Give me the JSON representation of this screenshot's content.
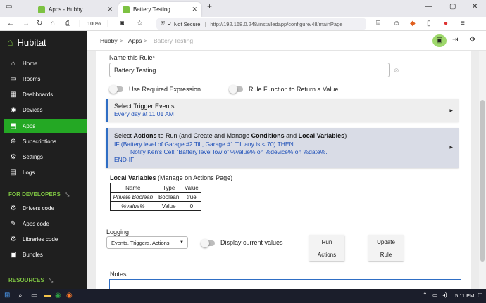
{
  "browser": {
    "tabs": [
      {
        "label": "Apps - Hubby",
        "active": false
      },
      {
        "label": "Battery Testing",
        "active": true
      }
    ],
    "new_tab": "+",
    "zoom": "100%",
    "security": "Not Secure",
    "url": "http://192.168.0.248/installedapp/configure/48/mainPage"
  },
  "sidebar": {
    "brand": "Hubitat",
    "items": [
      {
        "label": "Home",
        "icon": "home-icon",
        "glyph": "⌂"
      },
      {
        "label": "Rooms",
        "icon": "rooms-icon",
        "glyph": "▭"
      },
      {
        "label": "Dashboards",
        "icon": "dashboard-icon",
        "glyph": "▦"
      },
      {
        "label": "Devices",
        "icon": "bulb-icon",
        "glyph": "◉"
      },
      {
        "label": "Apps",
        "icon": "apps-icon",
        "glyph": "⬒"
      },
      {
        "label": "Subscriptions",
        "icon": "subscriptions-icon",
        "glyph": "⊛"
      },
      {
        "label": "Settings",
        "icon": "gear-icon",
        "glyph": "⚙"
      },
      {
        "label": "Logs",
        "icon": "logs-icon",
        "glyph": "▤"
      }
    ],
    "dev_section": "FOR DEVELOPERS",
    "dev_items": [
      {
        "label": "Drivers code",
        "icon": "code-icon",
        "glyph": "⚙"
      },
      {
        "label": "Apps code",
        "icon": "code-icon",
        "glyph": "✎"
      },
      {
        "label": "Libraries code",
        "icon": "code-icon",
        "glyph": "⚙"
      },
      {
        "label": "Bundles",
        "icon": "bundle-icon",
        "glyph": "▣"
      }
    ],
    "resources_section": "RESOURCES",
    "accent": "#24a824"
  },
  "header": {
    "breadcrumbs": [
      "Hubby",
      "Apps",
      "Battery Testing"
    ]
  },
  "form": {
    "name_label": "Name this Rule*",
    "name_value": "Battery Testing",
    "toggle1": "Use Required Expression",
    "toggle2": "Rule Function to Return a Value",
    "trigger_title": "Select Trigger Events",
    "trigger_value": "Every day at 11:01 AM",
    "actions_title_parts": [
      "Select ",
      "Actions",
      " to Run (and Create and Manage ",
      "Conditions",
      " and ",
      "Local Variables",
      ")"
    ],
    "actions_lines": [
      "IF (Battery level of Garage #2 Tilt, Garage #1 Tilt any is < 70) THEN",
      "Notify Ken's Cell: 'Battery level low of %value% on %device% on %date%.'",
      "END-IF"
    ],
    "local_vars_title": "Local Variables",
    "local_vars_note": " (Manage on Actions Page)",
    "local_vars_headers": [
      "Name",
      "Type",
      "Value"
    ],
    "local_vars_rows": [
      [
        "Private Boolean",
        "Boolean",
        "true"
      ],
      [
        "%value%",
        "Value",
        "0"
      ]
    ],
    "logging_label": "Logging",
    "logging_value": "Events, Triggers, Actions",
    "display_current": "Display current values",
    "run_button": [
      "Run",
      "Actions"
    ],
    "update_button": [
      "Update",
      "Rule"
    ],
    "notes_label": "Notes"
  },
  "taskbar": {
    "time": "5:11 PM"
  }
}
